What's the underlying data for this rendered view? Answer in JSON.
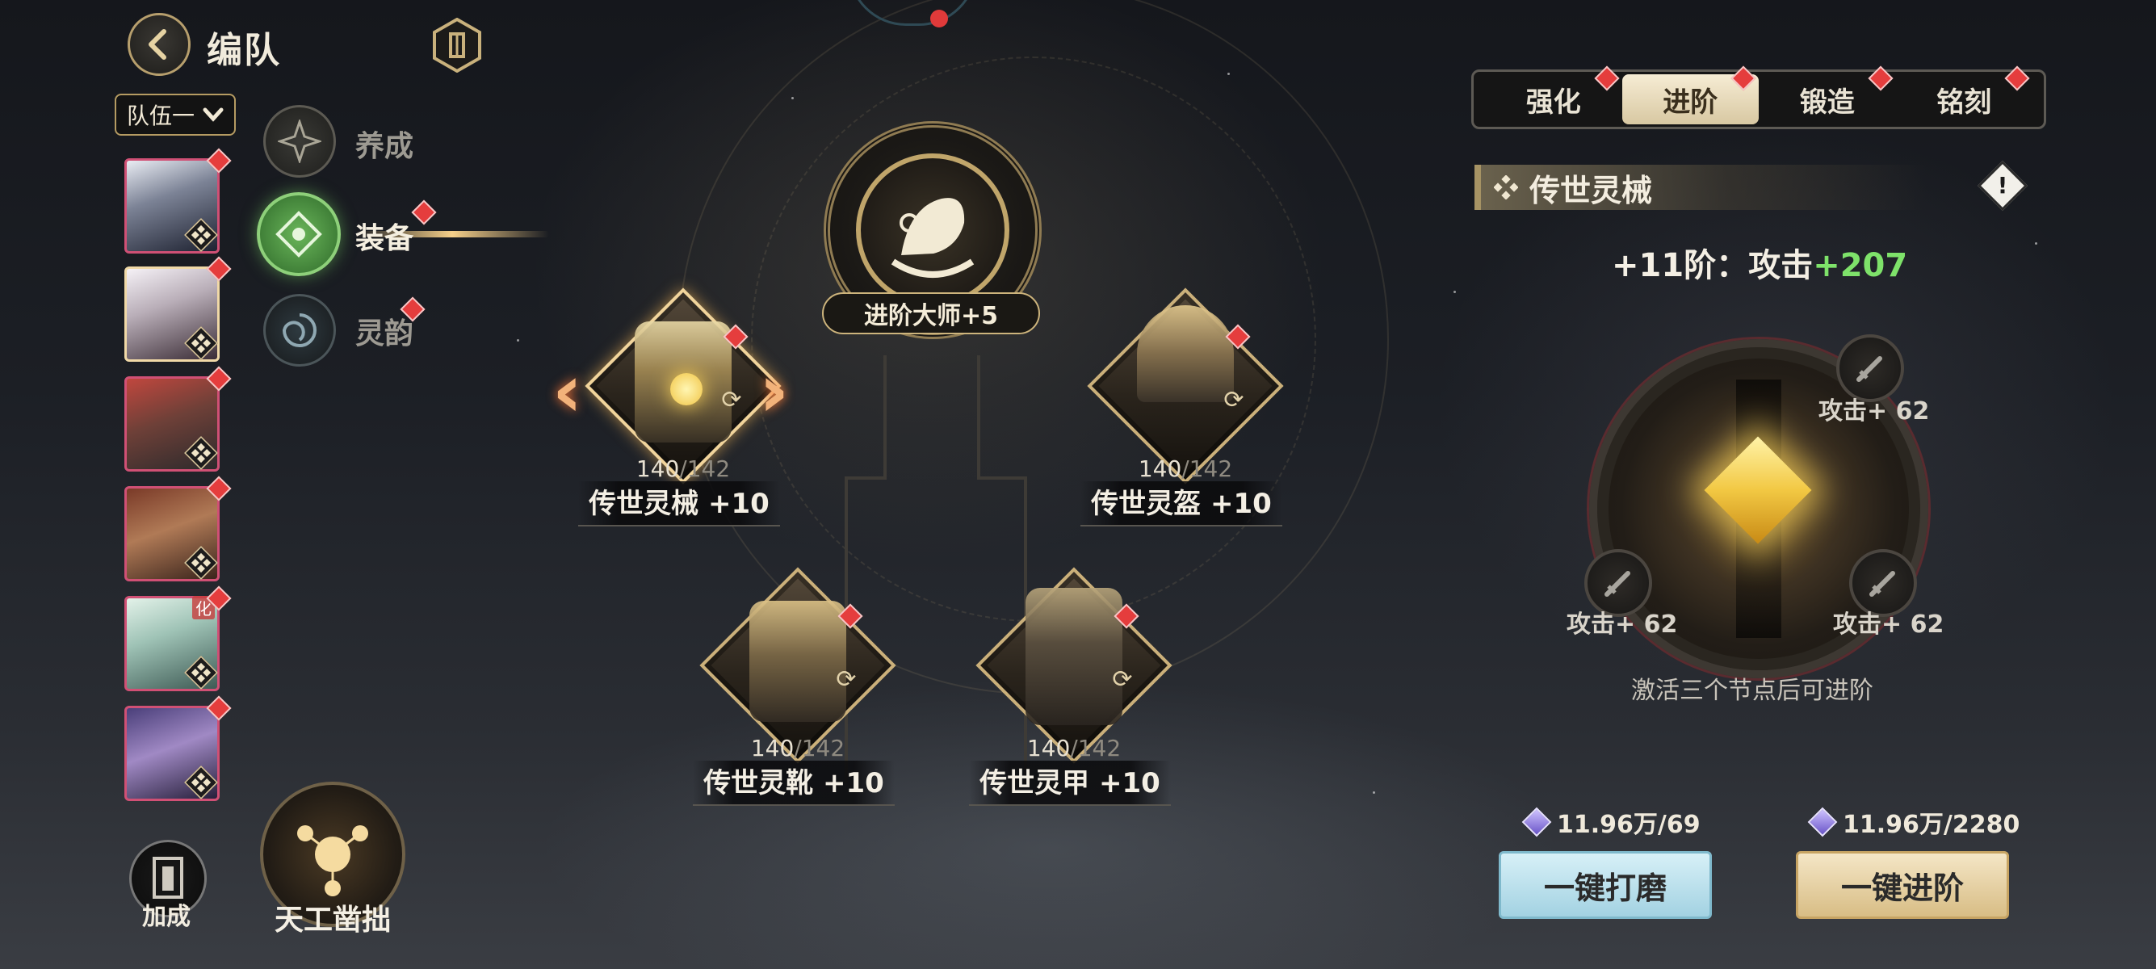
{
  "header": {
    "title": "编队"
  },
  "team": {
    "selected": "队伍一"
  },
  "nav": {
    "tabs": [
      {
        "label": "养成"
      },
      {
        "label": "装备"
      },
      {
        "label": "灵韵"
      }
    ]
  },
  "portraits": [
    {
      "badge": ""
    },
    {
      "badge": ""
    },
    {
      "badge": ""
    },
    {
      "badge": ""
    },
    {
      "badge": "化"
    },
    {
      "badge": ""
    }
  ],
  "bottom_left": {
    "bonus_label": "加成",
    "craft_label": "天工凿拙"
  },
  "master": {
    "label": "进阶大师+5"
  },
  "equipment": [
    {
      "name": "传世灵械 +10",
      "progress": "140",
      "max": "/142"
    },
    {
      "name": "传世灵盔 +10",
      "progress": "140",
      "max": "/142"
    },
    {
      "name": "传世灵靴 +10",
      "progress": "140",
      "max": "/142"
    },
    {
      "name": "传世灵甲 +10",
      "progress": "140",
      "max": "/142"
    }
  ],
  "right_tabs": [
    {
      "label": "强化"
    },
    {
      "label": "进阶"
    },
    {
      "label": "锻造"
    },
    {
      "label": "铭刻"
    }
  ],
  "panel": {
    "section_title": "传世灵械",
    "stage_prefix": "+11阶：攻击",
    "stage_bonus": "+207",
    "nodes": [
      {
        "label": "攻击+ 62"
      },
      {
        "label": "攻击+ 62"
      },
      {
        "label": "攻击+ 62"
      }
    ],
    "hint": "激活三个节点后可进阶",
    "costs": [
      {
        "amount": "11.96万/69"
      },
      {
        "amount": "11.96万/2280"
      }
    ],
    "buttons": {
      "polish": "一键打磨",
      "advance": "一键进阶"
    }
  },
  "colors": {
    "accent_gold": "#cbb07a",
    "alert_red": "#e53d3d",
    "stage_green": "#7ee26a",
    "polish_button": "#a3d2e2",
    "advance_button": "#d8bd85"
  }
}
